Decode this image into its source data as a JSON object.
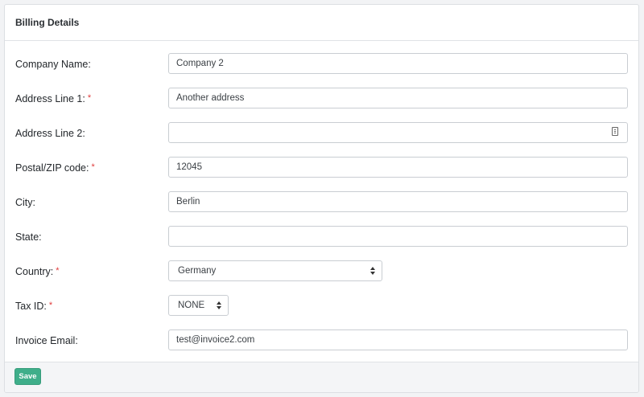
{
  "header": {
    "title": "Billing Details"
  },
  "fields": {
    "company_name": {
      "label": "Company Name:",
      "value": "Company 2"
    },
    "address_line_1": {
      "label": "Address Line 1:",
      "required": "*",
      "value": "Another address"
    },
    "address_line_2": {
      "label": "Address Line 2:",
      "value": ""
    },
    "postal_code": {
      "label": "Postal/ZIP code:",
      "required": "*",
      "value": "12045"
    },
    "city": {
      "label": "City:",
      "value": "Berlin"
    },
    "state": {
      "label": "State:",
      "value": ""
    },
    "country": {
      "label": "Country:",
      "required": "*",
      "selected": "Germany"
    },
    "tax_id": {
      "label": "Tax ID:",
      "required": "*",
      "selected": "NONE"
    },
    "invoice_email": {
      "label": "Invoice Email:",
      "value": "test@invoice2.com"
    }
  },
  "footer": {
    "save_label": "Save"
  },
  "colors": {
    "accent": "#3fae8a",
    "required": "#e03b3b"
  },
  "icons": {
    "autofill": "contact-card-icon",
    "select": "up-down-arrows-icon"
  }
}
